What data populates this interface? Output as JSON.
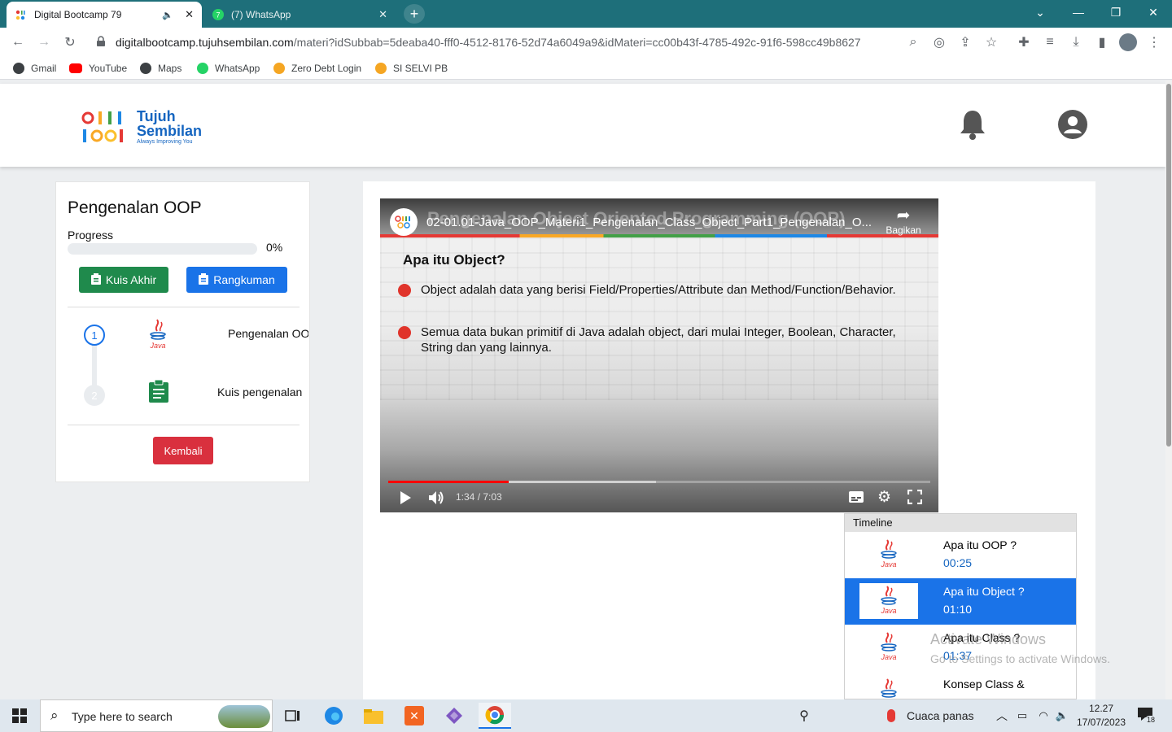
{
  "browser": {
    "tabs": [
      {
        "title": "Digital Bootcamp 79",
        "active": true
      },
      {
        "title": "(7) WhatsApp",
        "active": false
      }
    ],
    "url_host": "digitalbootcamp.tujuhsembilan.com",
    "url_path": "/materi?idSubbab=5deaba40-fff0-4512-8176-52d74a6049a9&idMateri=cc00b43f-4785-492c-91f6-598cc49b8627",
    "bookmarks": [
      "Gmail",
      "YouTube",
      "Maps",
      "WhatsApp",
      "Zero Debt Login",
      "SI SELVI PB"
    ]
  },
  "header": {
    "logo_line1": "Tujuh",
    "logo_line2": "Sembilan",
    "logo_tagline": "Always Improving You"
  },
  "sidebar": {
    "title": "Pengenalan OOP",
    "progress_label": "Progress",
    "progress_value": "0%",
    "progress_fraction": 0,
    "quiz_button": "Kuis Akhir",
    "summary_button": "Rangkuman",
    "steps": [
      {
        "number": "1",
        "label": "Pengenalan OOP",
        "icon": "java-icon"
      },
      {
        "number": "2",
        "label": "Kuis pengenalan",
        "icon": "clipboard-icon"
      }
    ],
    "back_button": "Kembali"
  },
  "video": {
    "channel_title": "Pengenalan Object Oriented Programming (OOP)",
    "video_title": "02-01.01-Java_OOP_Materi1_Pengenalan_Class_Object_Part1_Pengenalan_O...",
    "share_label": "Bagikan",
    "slide_heading": "Apa itu Object?",
    "slide_bullets": [
      "Object adalah data yang berisi Field/Properties/Attribute dan Method/Function/Behavior.",
      "Semua data bukan primitif di Java adalah object, dari mulai Integer, Boolean, Character, String dan yang lainnya."
    ],
    "time": "1:34 / 7:03",
    "played_fraction": 0.222,
    "buffered_fraction": 0.494
  },
  "timeline": {
    "header": "Timeline",
    "items": [
      {
        "title": "Apa itu OOP ?",
        "time": "00:25",
        "active": false
      },
      {
        "title": "Apa itu Object ?",
        "time": "01:10",
        "active": true
      },
      {
        "title": "Apa itu Class ?",
        "time": "01:37",
        "active": false
      },
      {
        "title": "Konsep Class &",
        "time": "",
        "active": false
      }
    ]
  },
  "watermark": {
    "line1": "Activate Windows",
    "line2": "Go to Settings to activate Windows."
  },
  "taskbar": {
    "search_placeholder": "Type here to search",
    "weather": "Cuaca panas",
    "time": "12.27",
    "date": "17/07/2023",
    "notification_count": "18"
  },
  "colors": {
    "tabstrip": "#1e6f7a",
    "green_button": "#1f8a4c",
    "blue_button": "#1a73e8",
    "red_button": "#d9303e",
    "timeline_active": "#1a73e8"
  }
}
